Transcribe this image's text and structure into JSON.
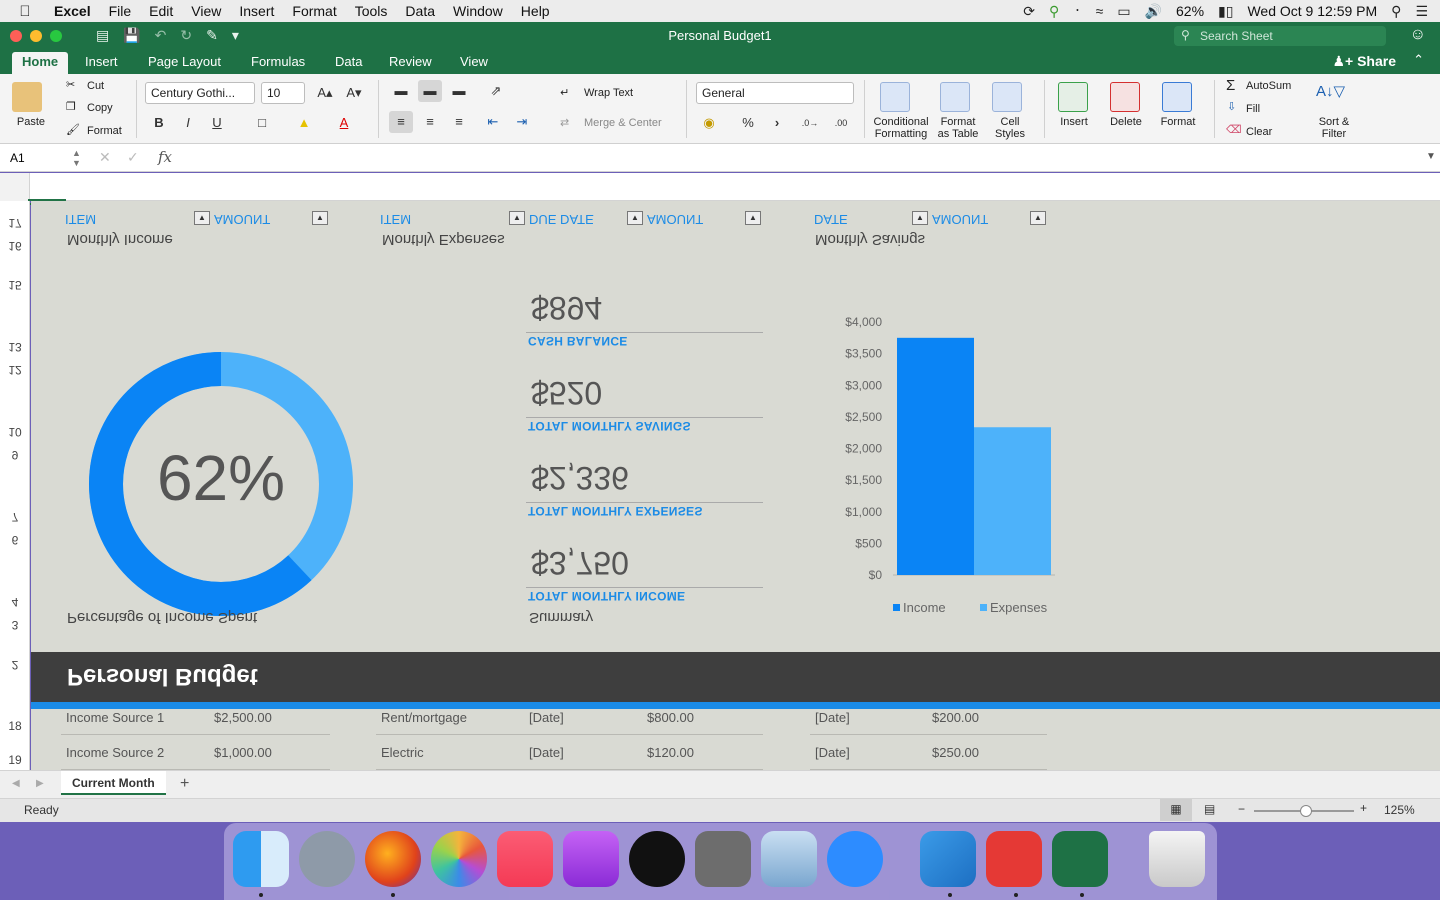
{
  "menubar": {
    "app": "Excel",
    "items": [
      "File",
      "Edit",
      "View",
      "Insert",
      "Format",
      "Tools",
      "Data",
      "Window",
      "Help"
    ],
    "battery": "62%",
    "clock": "Wed Oct 9  12:59 PM"
  },
  "window": {
    "title": "Personal Budget1",
    "search_placeholder": "Search Sheet"
  },
  "ribbon_tabs": [
    "Home",
    "Insert",
    "Page Layout",
    "Formulas",
    "Data",
    "Review",
    "View"
  ],
  "share_label": "Share",
  "ribbon": {
    "paste": "Paste",
    "cut": "Cut",
    "copy": "Copy",
    "format_painter": "Format",
    "font_name": "Century Gothi...",
    "font_size": "10",
    "bold": "B",
    "italic": "I",
    "underline": "U",
    "wrap_text": "Wrap Text",
    "merge_center": "Merge & Center",
    "number_format": "General",
    "percent": "%",
    "comma": "›",
    "conditional_formatting": [
      "Conditional",
      "Formatting"
    ],
    "format_as_table": [
      "Format",
      "as Table"
    ],
    "cell_styles": [
      "Cell",
      "Styles"
    ],
    "insert": "Insert",
    "delete": "Delete",
    "format": "Format",
    "autosum": "AutoSum",
    "fill": "Fill",
    "clear": "Clear",
    "sort_filter": [
      "Sort &",
      "Filter"
    ]
  },
  "formula_bar": {
    "name_box": "A1",
    "fx": "fx",
    "content": ""
  },
  "row_numbers": {
    "flipped": [
      "17",
      "16",
      "15",
      "13",
      "12",
      "10",
      "9",
      "7",
      "6",
      "4",
      "3",
      "2"
    ],
    "normal": [
      "18",
      "19"
    ]
  },
  "sheet": {
    "income_headers": {
      "item": "ITEM",
      "amount": "AMOUNT"
    },
    "expense_headers": {
      "item": "ITEM",
      "due_date": "DUE DATE",
      "amount": "AMOUNT"
    },
    "savings_headers": {
      "date": "DATE",
      "amount": "AMOUNT"
    },
    "monthly_income": "Monthly Income",
    "monthly_expenses": "Monthly Expenses",
    "monthly_savings": "Monthly Savings",
    "percentage_label": "Percentage of Income Spent",
    "percentage_value": "62%",
    "percent_spent": 0.62,
    "summary_label": "Summary",
    "summary": [
      {
        "value": "$894",
        "label": "CASH BALANCE"
      },
      {
        "value": "$520",
        "label": "TOTAL MONTHLY SAVINGS"
      },
      {
        "value": "$2,336",
        "label": "TOTAL MONTHLY EXPENSES"
      },
      {
        "value": "$3,750",
        "label": "TOTAL MONTHLY INCOME"
      }
    ],
    "banner_title": "Personal Budget",
    "income_rows": [
      {
        "item": "Income Source 1",
        "amount": "$2,500.00"
      },
      {
        "item": "Income Source 2",
        "amount": "$1,000.00"
      }
    ],
    "expense_rows": [
      {
        "item": "Rent/mortgage",
        "due": "[Date]",
        "amount": "$800.00"
      },
      {
        "item": "Electric",
        "due": "[Date]",
        "amount": "$120.00"
      }
    ],
    "savings_rows": [
      {
        "date": "[Date]",
        "amount": "$200.00"
      },
      {
        "date": "[Date]",
        "amount": "$250.00"
      }
    ]
  },
  "chart_data": {
    "type": "bar",
    "categories": [
      ""
    ],
    "series": [
      {
        "name": "Income",
        "values": [
          3750
        ],
        "color": "#0a84f5"
      },
      {
        "name": "Expenses",
        "values": [
          2336
        ],
        "color": "#4db2fa"
      }
    ],
    "yticks": [
      "$0",
      "$500",
      "$1,000",
      "$1,500",
      "$2,000",
      "$2,500",
      "$3,000",
      "$3,500",
      "$4,000"
    ],
    "ylim": [
      0,
      4000
    ],
    "legend": "bottom"
  },
  "sheet_tabs": [
    "Current Month"
  ],
  "status": {
    "ready": "Ready",
    "zoom": "125%"
  },
  "dock": [
    "finder",
    "launchpad",
    "firefox",
    "photos",
    "music",
    "podcasts",
    "apple-tv",
    "system-preferences",
    "preview",
    "zoom",
    "keychain",
    "pdf-expert",
    "excel",
    "trash"
  ]
}
